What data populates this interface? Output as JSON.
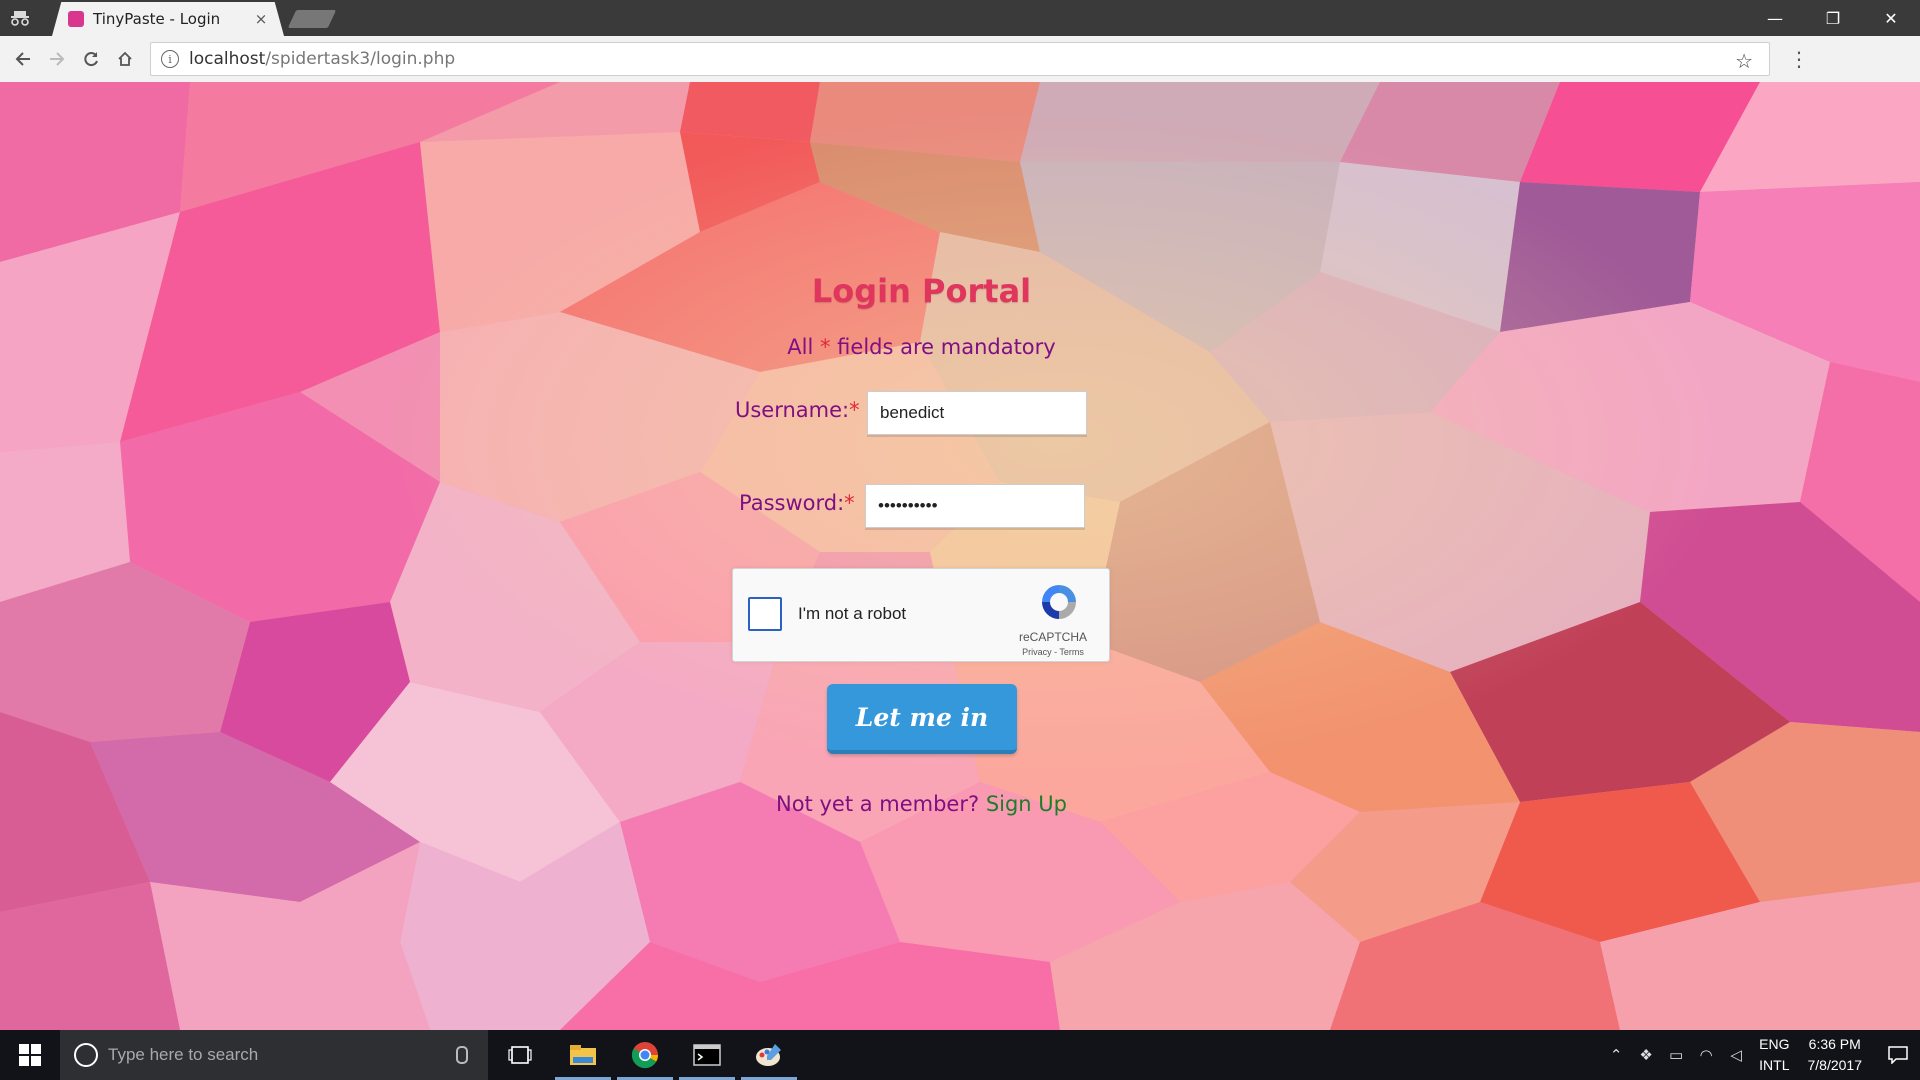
{
  "browser": {
    "tab_title": "TinyPaste - Login",
    "tab_close": "×",
    "url_host": "localhost",
    "url_path": "/spidertask3/login.php",
    "window_controls": {
      "minimize": "—",
      "restore": "❐",
      "close": "✕"
    }
  },
  "login": {
    "title": "Login Portal",
    "mandatory_prefix": "All ",
    "mandatory_star": "*",
    "mandatory_suffix": " fields are mandatory",
    "username_label": "Username:",
    "username_star": "*",
    "username_value": "benedict",
    "password_label": "Password:",
    "password_star": "*",
    "password_value": "••••••••••",
    "captcha_text": "I'm not a robot",
    "captcha_brand": "reCAPTCHA",
    "captcha_links": "Privacy - Terms",
    "submit_label": "Let me in",
    "signup_prompt": "Not yet a member? ",
    "signup_link": "Sign Up"
  },
  "taskbar": {
    "search_placeholder": "Type here to search",
    "lang_top": "ENG",
    "lang_bottom": "INTL",
    "time": "6:36 PM",
    "date": "7/8/2017"
  },
  "colors": {
    "title": "#e0355d",
    "label": "#7f0f83",
    "required": "#e02a3a",
    "button": "#3498db",
    "signup_link": "#1f7d2a"
  }
}
